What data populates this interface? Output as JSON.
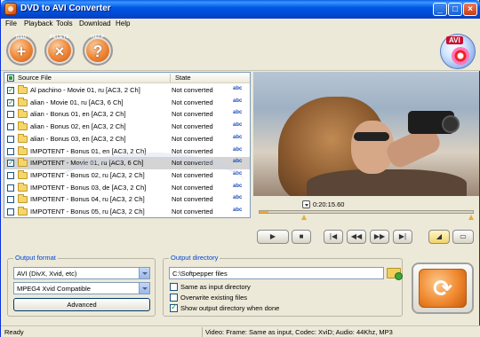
{
  "window": {
    "title": "DVD to AVI Converter"
  },
  "menu": [
    "File",
    "Playback",
    "Tools",
    "Download",
    "Help"
  ],
  "toolbar": {
    "add_label": "DVD",
    "delete_label": "DELETE",
    "help_label": "HELP",
    "logo_text": "AVI"
  },
  "list": {
    "col_source": "Source File",
    "col_state": "State",
    "rows": [
      {
        "name": "Al pachino - Movie 01, ru [AC3, 2 Ch]",
        "state": "Not converted",
        "checked": true,
        "selected": false
      },
      {
        "name": "alian - Movie 01, ru [AC3, 6 Ch]",
        "state": "Not converted",
        "checked": true,
        "selected": false
      },
      {
        "name": "alian - Bonus 01, en [AC3, 2 Ch]",
        "state": "Not converted",
        "checked": false,
        "selected": false
      },
      {
        "name": "alian - Bonus 02, en [AC3, 2 Ch]",
        "state": "Not converted",
        "checked": false,
        "selected": false
      },
      {
        "name": "alian - Bonus 03, en [AC3, 2 Ch]",
        "state": "Not converted",
        "checked": false,
        "selected": false
      },
      {
        "name": "IMPOTENT - Bonus 01, en [AC3, 2 Ch]",
        "state": "Not converted",
        "checked": false,
        "selected": false
      },
      {
        "name": "IMPOTENT - Movie 01, ru [AC3, 6 Ch]",
        "state": "Not converted",
        "checked": true,
        "selected": true
      },
      {
        "name": "IMPOTENT - Bonus 02, ru [AC3, 2 Ch]",
        "state": "Not converted",
        "checked": false,
        "selected": false
      },
      {
        "name": "IMPOTENT - Bonus 03, de [AC3, 2 Ch]",
        "state": "Not converted",
        "checked": false,
        "selected": false
      },
      {
        "name": "IMPOTENT - Bonus 04, ru [AC3, 2 Ch]",
        "state": "Not converted",
        "checked": false,
        "selected": false
      },
      {
        "name": "IMPOTENT - Bonus 05, ru [AC3, 2 Ch]",
        "state": "Not converted",
        "checked": false,
        "selected": false
      }
    ],
    "abc": "abc"
  },
  "player": {
    "time": "0:20:15.60",
    "progress": 0.04
  },
  "output_format": {
    "title": "Output format",
    "format": "AVI (DivX, Xvid, etc)",
    "codec": "MPEG4 Xvid Compatible",
    "advanced_label": "Advanced"
  },
  "output_directory": {
    "title": "Output directory",
    "path": "C:\\Softpepper files",
    "same_as_input": "Same as input directory",
    "overwrite": "Overwrite existing files",
    "show_dir": "Show output directory when done",
    "same_checked": false,
    "overwrite_checked": false,
    "show_checked": true
  },
  "status": {
    "left": "Ready",
    "right": "Video: Frame: Same as input, Codec: XviD; Audio: 44Khz, MP3"
  }
}
